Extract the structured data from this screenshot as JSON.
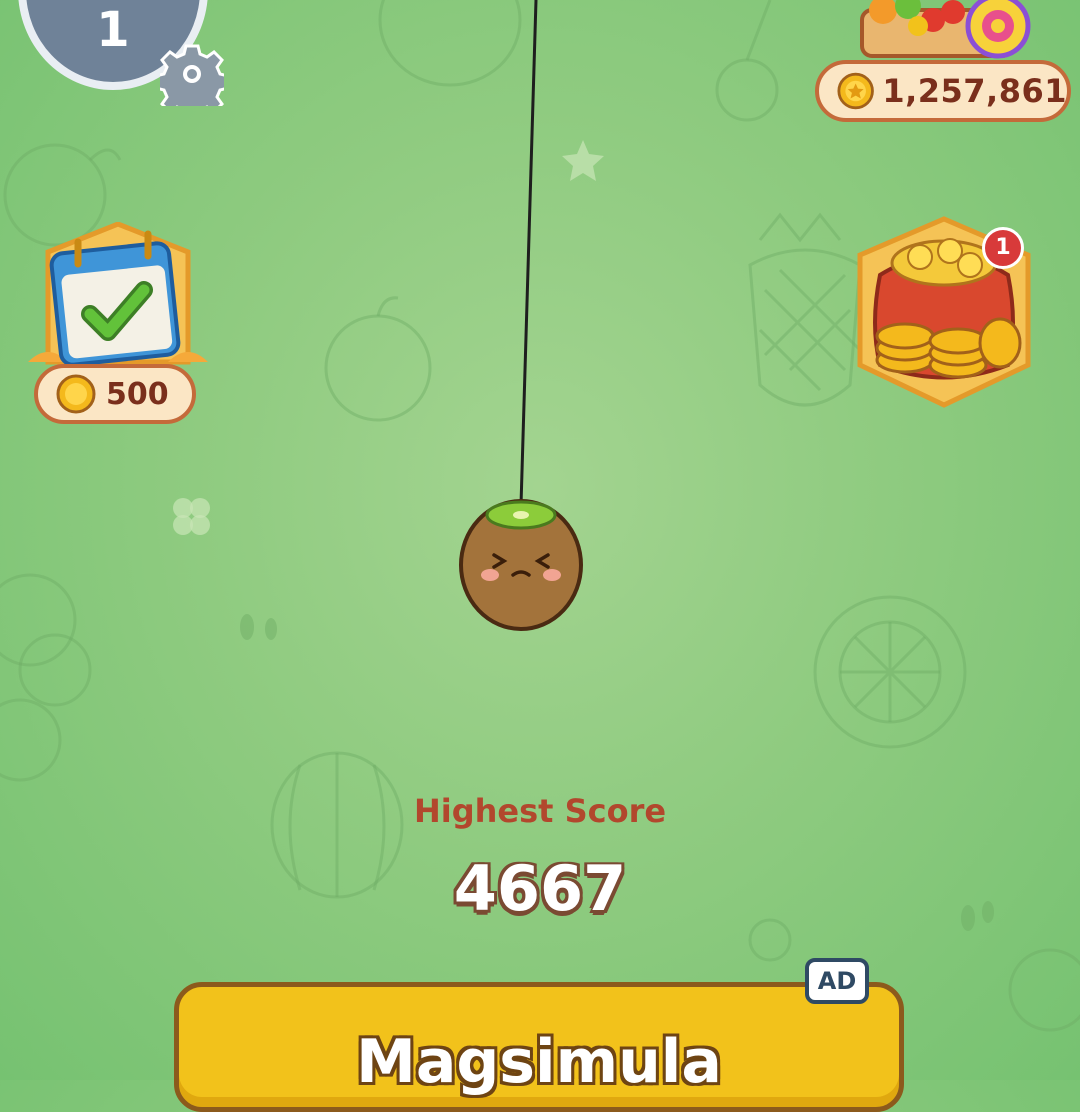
{
  "hud": {
    "level": "1",
    "coins": "1,257,861",
    "daily_reward": "500",
    "bag_notification_count": "1"
  },
  "current_fruit": "kiwi",
  "score": {
    "label": "Highest Score",
    "value": "4667"
  },
  "restart": {
    "label": "Magsimula",
    "ad_badge": "AD"
  },
  "icons": {
    "settings": "gear-icon",
    "coin": "coin-icon",
    "shop": "shop-icon",
    "daily": "calendar-check-icon",
    "bag": "coin-bag-icon"
  },
  "colors": {
    "background": "#8fcb80",
    "button": "#f2c21b",
    "score_label": "#b2472d",
    "pill_border": "#c46a3a"
  }
}
